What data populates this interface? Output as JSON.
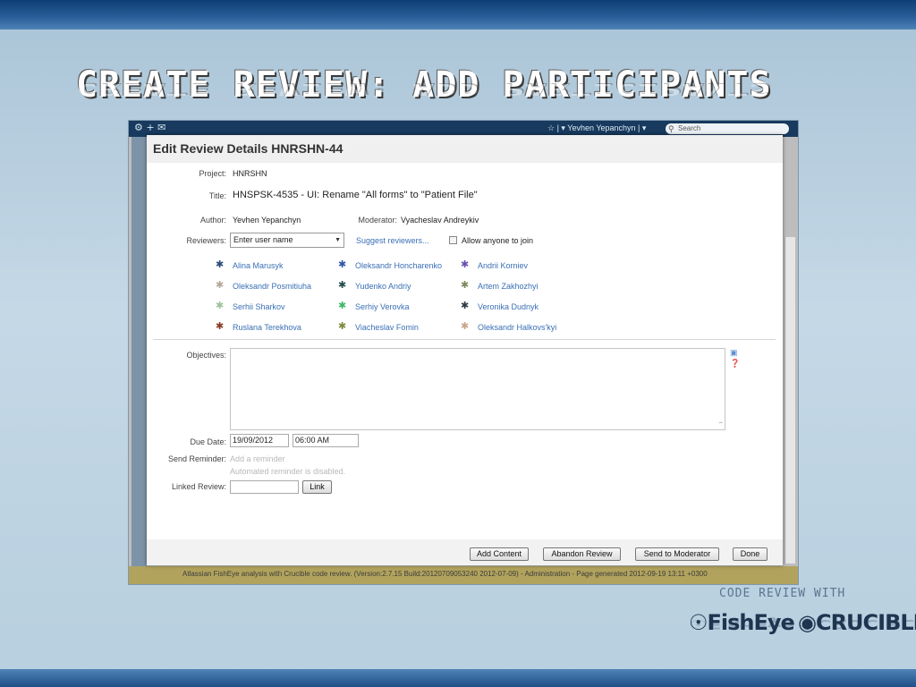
{
  "slide": {
    "title": "CREATE REVIEW: ADD PARTICIPANTS",
    "brand_tag": "CODE REVIEW WITH",
    "logo_fisheye": "FishEye",
    "logo_crucible": "CRUCIBLE"
  },
  "app": {
    "user_name": "Yevhen Yepanchyn",
    "search_placeholder": "Search",
    "footer_text": "Atlassian FishEye analysis with Crucible code review. (Version:2.7.15 Build:20120709053240 2012-07-09) - Administration - Page generated 2012-09-19 13:11 +0300"
  },
  "dialog": {
    "title": "Edit Review Details HNRSHN-44",
    "project_label": "Project:",
    "project_value": "HNRSHN",
    "title_label": "Title:",
    "title_value": "HNSPSK-4535 - UI: Rename \"All forms\" to \"Patient File\"",
    "author_label": "Author:",
    "author_value": "Yevhen Yepanchyn",
    "moderator_label": "Moderator:",
    "moderator_value": "Vyacheslav Andreykiv",
    "reviewers_label": "Reviewers:",
    "reviewer_input_value": "Enter user name",
    "suggest_reviewers": "Suggest reviewers...",
    "allow_anyone_label": "Allow anyone to join",
    "participants": [
      {
        "name": "Alina Marusyk",
        "color": "#2b4a7a"
      },
      {
        "name": "Oleksandr Honcharenko",
        "color": "#2f57a8"
      },
      {
        "name": "Andrii Korniev",
        "color": "#6a4fb0"
      },
      {
        "name": "Oleksandr Posmitiuha",
        "color": "#b5a79a"
      },
      {
        "name": "Yudenko Andriy",
        "color": "#1f4d4a"
      },
      {
        "name": "Artem Zakhozhyi",
        "color": "#7b8a5a"
      },
      {
        "name": "Serhii Sharkov",
        "color": "#9dc29d"
      },
      {
        "name": "Serhiy Verovka",
        "color": "#3fb76a"
      },
      {
        "name": "Veronika Dudnyk",
        "color": "#2e3b47"
      },
      {
        "name": "Ruslana Terekhova",
        "color": "#8a3b24"
      },
      {
        "name": "Viacheslav Fomin",
        "color": "#7c8a3a"
      },
      {
        "name": "Oleksandr Halkovs'kyi",
        "color": "#c9a48a"
      }
    ],
    "objectives_label": "Objectives:",
    "due_date_label": "Due Date:",
    "due_date_value": "19/09/2012",
    "due_time_value": "06:00 AM",
    "send_reminder_label": "Send Reminder:",
    "add_reminder": "Add a reminder",
    "reminder_disabled": "Automated reminder is disabled.",
    "linked_review_label": "Linked Review:",
    "link_button": "Link",
    "buttons": {
      "add_content": "Add Content",
      "abandon_review": "Abandon Review",
      "send_to_moderator": "Send to Moderator",
      "done": "Done"
    }
  }
}
